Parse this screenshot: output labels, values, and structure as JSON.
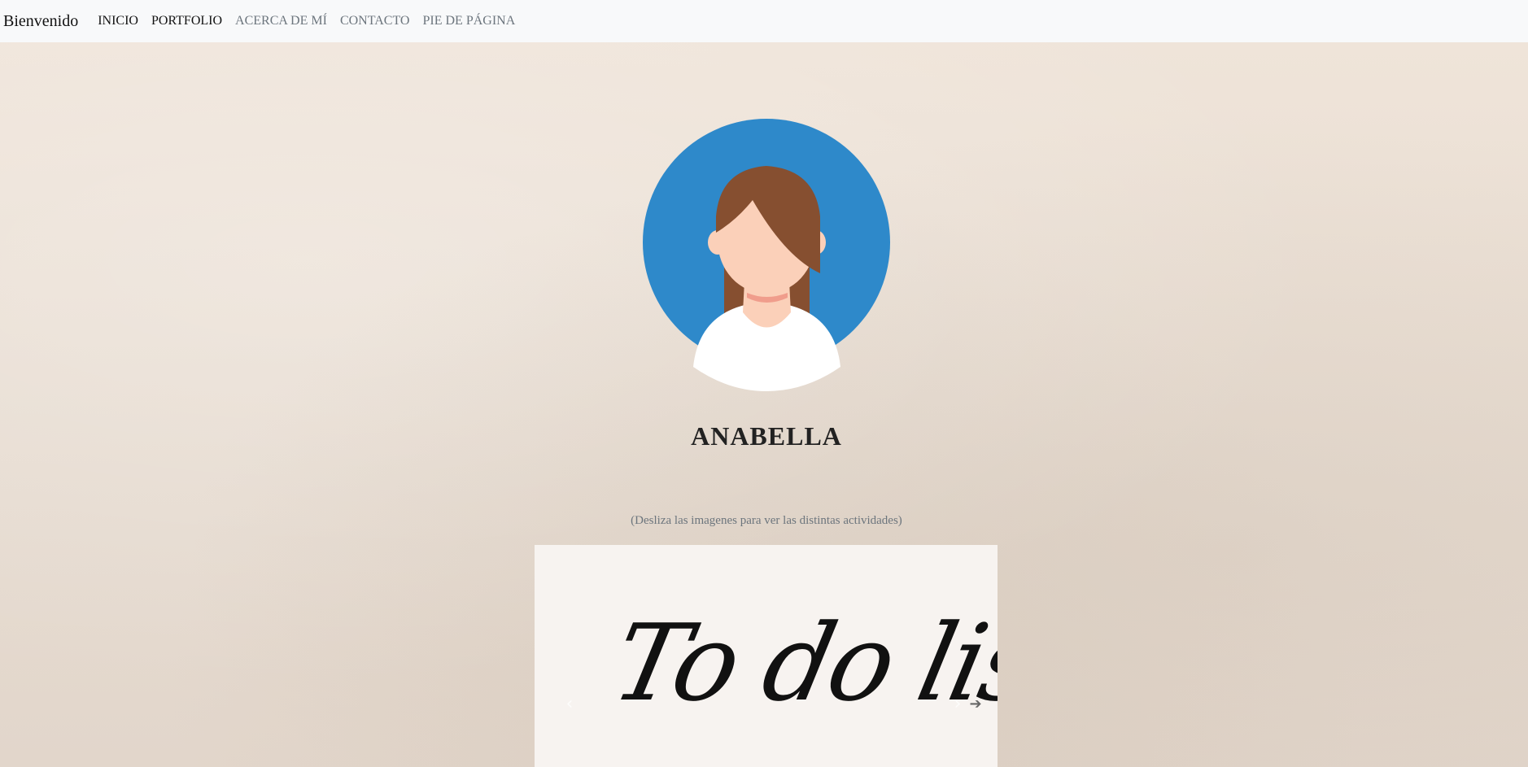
{
  "navbar": {
    "brand": "Bienvenido",
    "items": [
      {
        "label": "INICIO",
        "active": true
      },
      {
        "label": "PORTFOLIO",
        "active": true
      },
      {
        "label": "ACERCA DE MÍ",
        "active": false
      },
      {
        "label": "CONTACTO",
        "active": false
      },
      {
        "label": "PIE DE PÁGINA",
        "active": false
      }
    ]
  },
  "profile": {
    "avatar": "avatar-icon",
    "name": "ANABELLA",
    "colors": {
      "circle": "#2e89ca",
      "hair": "#864f30",
      "skin": "#fbd0b9",
      "shirt": "#ffffff"
    }
  },
  "carousel": {
    "hint": "(Desliza las imagenes para ver las distintas actividades)",
    "slide_title": "To do list",
    "prev_icon": "chevron-left-icon",
    "next_icon": "chevron-right-icon",
    "arrow_icon": "arrow-right-icon"
  }
}
